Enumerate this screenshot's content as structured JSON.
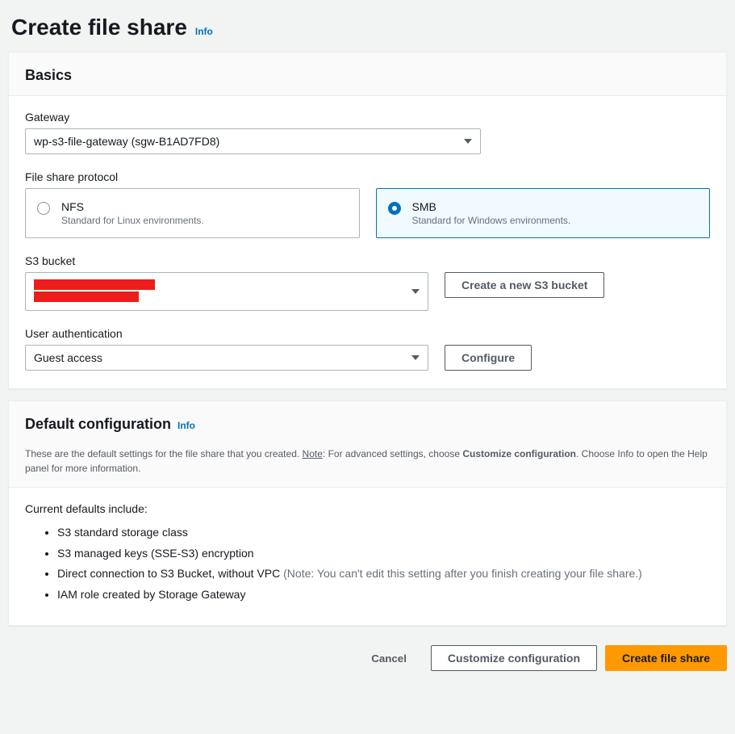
{
  "header": {
    "title": "Create file share",
    "info": "Info"
  },
  "basics": {
    "title": "Basics",
    "gateway_label": "Gateway",
    "gateway_value": "wp-s3-file-gateway (sgw-B1AD7FD8)",
    "protocol_label": "File share protocol",
    "protocol_options": [
      {
        "title": "NFS",
        "desc": "Standard for Linux environments.",
        "selected": false
      },
      {
        "title": "SMB",
        "desc": "Standard for Windows environments.",
        "selected": true
      }
    ],
    "s3_label": "S3 bucket",
    "s3_create_button": "Create a new S3 bucket",
    "auth_label": "User authentication",
    "auth_value": "Guest access",
    "configure_button": "Configure"
  },
  "defaults": {
    "title": "Default configuration",
    "info": "Info",
    "desc_prefix": "These are the default settings for the file share that you created. ",
    "desc_note_label": "Note",
    "desc_mid": ": For advanced settings, choose ",
    "desc_bold": "Customize configuration",
    "desc_suffix": ". Choose Info to open the Help panel for more information.",
    "current_label": "Current defaults include:",
    "items": [
      {
        "text": "S3 standard storage class",
        "note": ""
      },
      {
        "text": "S3 managed keys (SSE-S3) encryption",
        "note": ""
      },
      {
        "text": "Direct connection to S3 Bucket, without VPC ",
        "note": "(Note: You can't edit this setting after you finish creating your file share.)"
      },
      {
        "text": "IAM role created by Storage Gateway",
        "note": ""
      }
    ]
  },
  "footer": {
    "cancel": "Cancel",
    "customize": "Customize configuration",
    "create": "Create file share"
  }
}
